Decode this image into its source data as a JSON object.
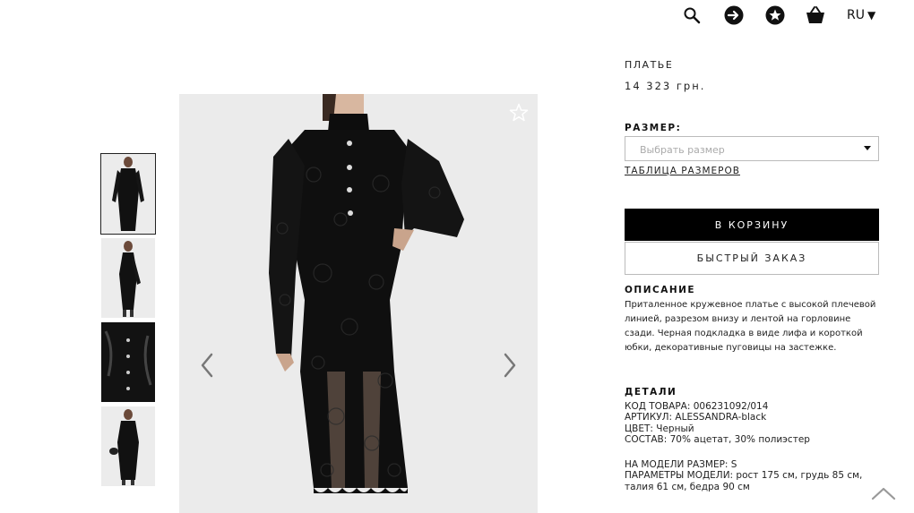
{
  "header": {
    "icons": [
      "search-icon",
      "login-icon",
      "favorites-icon",
      "cart-icon"
    ],
    "language": "RU"
  },
  "gallery": {
    "thumbnails": [
      "thumb-1",
      "thumb-2",
      "thumb-3",
      "thumb-4"
    ],
    "active_index": 0
  },
  "product": {
    "type": "ПЛАТЬЕ",
    "price": "14 323 грн.",
    "size_label": "РАЗМЕР:",
    "size_placeholder": "Выбрать размер",
    "size_table_link": "ТАБЛИЦА РАЗМЕРОВ",
    "add_to_cart": "В КОРЗИНУ",
    "quick_order": "БЫСТРЫЙ ЗАКАЗ",
    "description_title": "ОПИСАНИЕ",
    "description": "Приталенное кружевное платье с высокой плечевой линией, разрезом внизу и лентой на горловине сзади. Черная подкладка в виде лифа и короткой юбки, декоративные пуговицы на застежке.",
    "details_title": "ДЕТАЛИ",
    "details": {
      "code": "КОД ТОВАРА: 006231092/014",
      "article": "АРТИКУЛ: ALESSANDRA-black",
      "color": "ЦВЕТ: Черный",
      "composition": "СОСТАВ: 70% ацетат, 30% полиэстер",
      "model_size": "НА МОДЕЛИ РАЗМЕР: S",
      "model_params": "ПАРАМЕТРЫ МОДЕЛИ: рост 175 см, грудь 85 см, талия 61 см, бедра 90 см"
    }
  },
  "colors": {
    "accent": "#000000",
    "background": "#ffffff",
    "photo_bg": "#ebebeb"
  }
}
